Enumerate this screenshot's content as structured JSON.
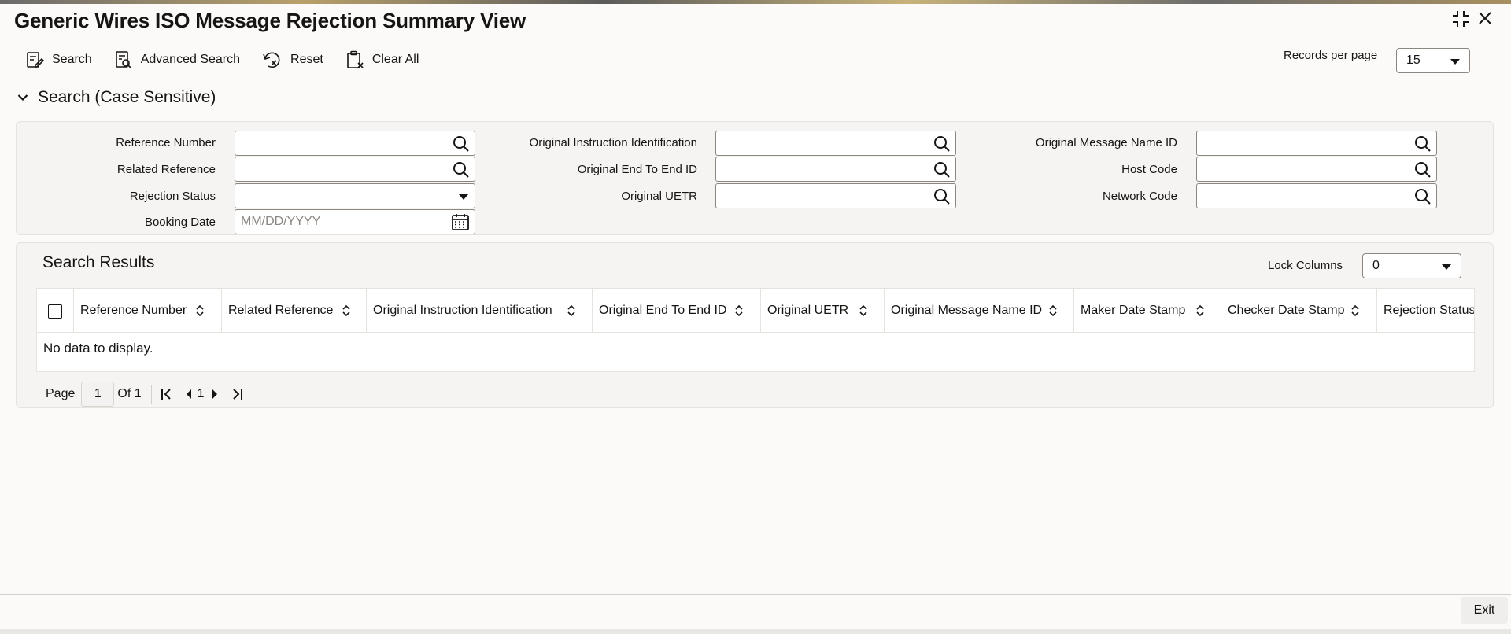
{
  "window": {
    "title": "Generic Wires ISO Message Rejection Summary View"
  },
  "toolbar": {
    "search_label": "Search",
    "advanced_search_label": "Advanced Search",
    "reset_label": "Reset",
    "clear_all_label": "Clear All"
  },
  "records_per_page": {
    "label": "Records per page",
    "value": "15"
  },
  "search_section": {
    "title": "Search (Case Sensitive)",
    "fields": {
      "reference_number": {
        "label": "Reference Number",
        "value": ""
      },
      "related_reference": {
        "label": "Related Reference",
        "value": ""
      },
      "rejection_status": {
        "label": "Rejection Status",
        "value": ""
      },
      "booking_date": {
        "label": "Booking Date",
        "placeholder": "MM/DD/YYYY"
      },
      "original_instruction_identification": {
        "label": "Original Instruction Identification",
        "value": ""
      },
      "original_end_to_end_id": {
        "label": "Original End To End ID",
        "value": ""
      },
      "original_uetr": {
        "label": "Original UETR",
        "value": ""
      },
      "original_message_name_id": {
        "label": "Original Message Name ID",
        "value": ""
      },
      "host_code": {
        "label": "Host Code",
        "value": ""
      },
      "network_code": {
        "label": "Network Code",
        "value": ""
      }
    }
  },
  "results": {
    "title": "Search Results",
    "lock_columns": {
      "label": "Lock Columns",
      "value": "0"
    },
    "columns": [
      "Reference Number",
      "Related Reference",
      "Original Instruction Identification",
      "Original End To End ID",
      "Original UETR",
      "Original Message Name ID",
      "Maker Date Stamp",
      "Checker Date Stamp",
      "Rejection Status"
    ],
    "empty_message": "No data to display."
  },
  "pager": {
    "page_label": "Page",
    "current_page": "1",
    "of_label": "Of 1",
    "page_link": "1"
  },
  "footer": {
    "exit_label": "Exit"
  },
  "colors": {
    "text": "#161513",
    "panel_bg": "#f5f4f2",
    "border": "#8b8680"
  }
}
